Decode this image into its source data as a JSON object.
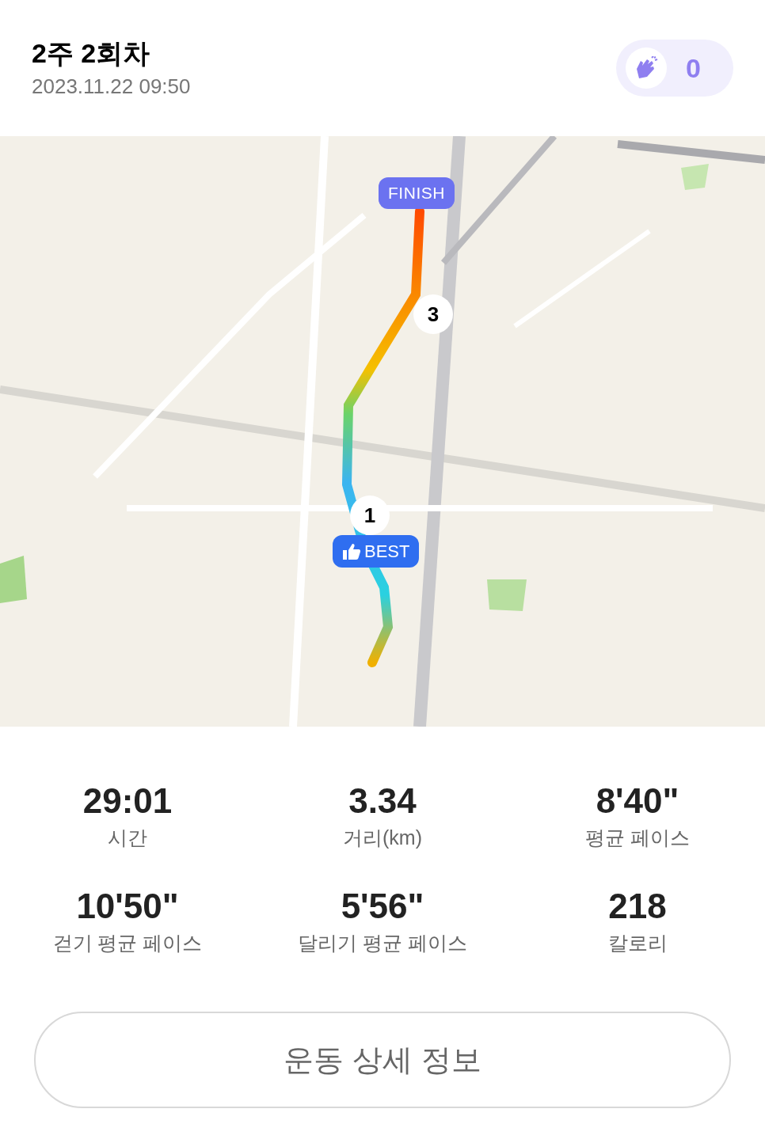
{
  "header": {
    "title": "2주 2회차",
    "datetime": "2023.11.22 09:50",
    "claps": "0"
  },
  "map": {
    "markers": [
      {
        "kind": "flag",
        "label": "FINISH"
      },
      {
        "kind": "km",
        "label": "3"
      },
      {
        "kind": "km",
        "label": "1"
      },
      {
        "kind": "best",
        "label": "BEST"
      }
    ]
  },
  "stats": [
    {
      "value": "29:01",
      "label": "시간"
    },
    {
      "value": "3.34",
      "label": "거리(km)"
    },
    {
      "value": "8'40\"",
      "label": "평균 페이스"
    },
    {
      "value": "10'50\"",
      "label": "걷기 평균 페이스"
    },
    {
      "value": "5'56\"",
      "label": "달리기 평균 페이스"
    },
    {
      "value": "218",
      "label": "칼로리"
    }
  ],
  "detail_button": "운동 상세 정보"
}
